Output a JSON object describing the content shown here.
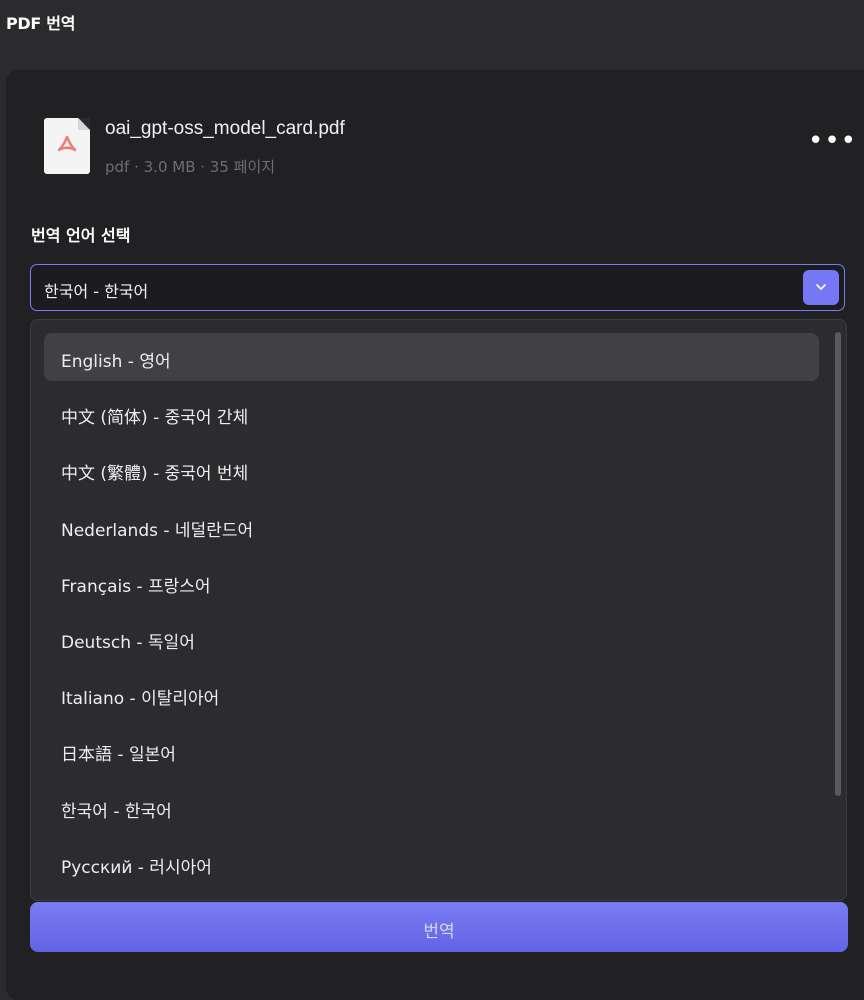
{
  "app": {
    "title": "PDF 번역"
  },
  "file": {
    "name": "oai_gpt-oss_model_card.pdf",
    "meta": "pdf · 3.0 MB · 35 페이지",
    "icon": "pdf-file-icon",
    "more_icon": "more-horizontal-icon",
    "more_glyph": "•••"
  },
  "language": {
    "label": "번역 언어 선택",
    "selected": "한국어 - 한국어",
    "dropdown_icon": "chevron-down-icon",
    "options": [
      "English  - 영어",
      "中文 (简体) - 중국어 간체",
      "中文 (繁體) - 중국어 번체",
      "Nederlands - 네덜란드어",
      "Français - 프랑스어",
      "Deutsch - 독일어",
      "Italiano - 이탈리아어",
      "日本語  - 일본어",
      "한국어  - 한국어",
      "Русский  - 러시아어"
    ],
    "highlighted_index": 0
  },
  "actions": {
    "translate_label": "번역"
  },
  "colors": {
    "accent": "#7577f5",
    "background": "#2b2b2d",
    "panel": "#212123",
    "dropdown": "#2c2c2e",
    "pdf_icon": "#f07b72"
  }
}
